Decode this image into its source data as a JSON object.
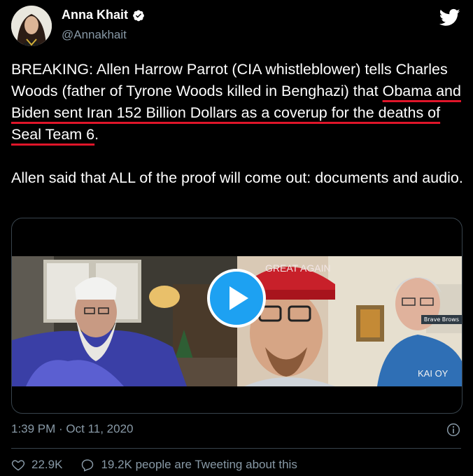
{
  "author": {
    "display_name": "Anna Khait",
    "handle": "@Annakhait",
    "verified": true,
    "avatar_icon": "avatar-photo"
  },
  "brand": {
    "logo_icon": "twitter-bird-icon",
    "accent": "#1da1f2"
  },
  "tweet": {
    "p1_a": "BREAKING: Allen Harrow Parrot (CIA whistleblower) tells Charles Woods (father of Tyrone Woods killed in Benghazi) that ",
    "p1_highlight": "Obama and Biden sent Iran 152 Billion Dollars as a coverup for the deaths of Seal Team 6",
    "p1_b": ".",
    "p2": "Allen said that ALL of the proof will come out: documents and audio.",
    "highlight_color": "#e0152a"
  },
  "media": {
    "type": "video",
    "play_icon": "play-icon",
    "name_tag": "Brave Brows",
    "hat_text": "GREAT AGAIN",
    "shirt_text": "KAI OY"
  },
  "meta": {
    "timestamp": "1:39 PM · Oct 11, 2020",
    "info_icon": "info-icon"
  },
  "engagement": {
    "likes": "22.9K",
    "tweeting": "19.2K people are Tweeting about this"
  }
}
